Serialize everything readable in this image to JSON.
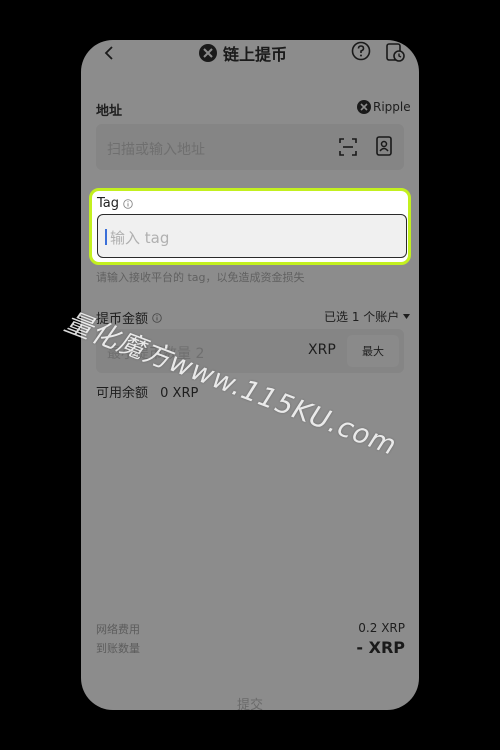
{
  "header": {
    "title": "链上提币",
    "icons": {
      "back": "back-arrow-icon",
      "logo": "xrp-logo-icon",
      "help": "help-icon",
      "history": "history-icon"
    }
  },
  "address": {
    "label": "地址",
    "network": "Ripple",
    "placeholder": "扫描或输入地址"
  },
  "tag": {
    "label": "Tag",
    "placeholder": "输入 tag",
    "hint": "请输入接收平台的 tag，以免造成资金损失"
  },
  "amount": {
    "label": "提币金额",
    "account_select": "已选 1 个账户",
    "placeholder": "最小提币数量 2",
    "currency": "XRP",
    "max_label": "最大"
  },
  "balance": {
    "label": "可用余额",
    "value": "0 XRP"
  },
  "summary": {
    "fee_label": "网络费用",
    "fee_value": "0.2 XRP",
    "receive_label": "到账数量",
    "receive_value": "- XRP"
  },
  "submit_label": "提交",
  "watermark": "量化魔方www.115KU.com",
  "colors": {
    "highlight": "#c3f01f",
    "caret": "#3b6fd8",
    "dim_overlay": "#8c8c8c"
  }
}
